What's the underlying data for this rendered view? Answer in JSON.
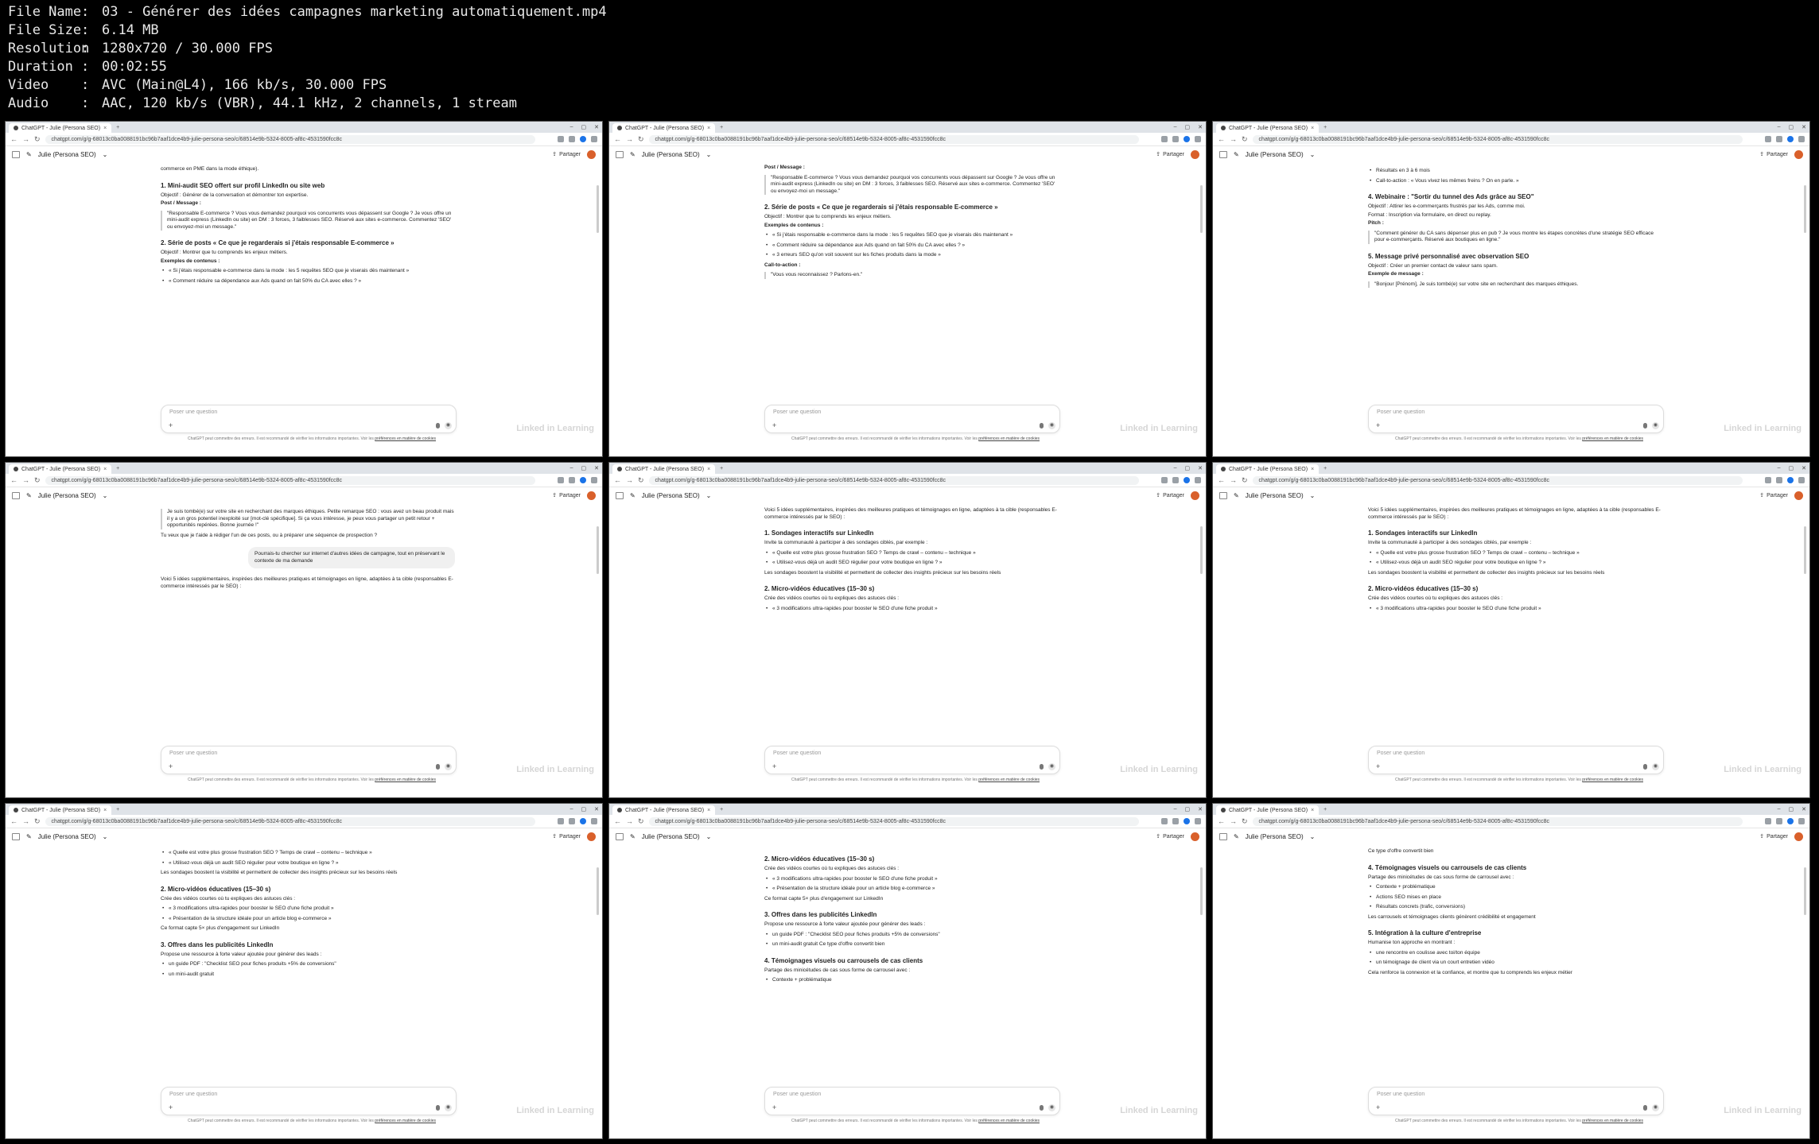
{
  "file_info": [
    {
      "key": "File Name",
      "value": "03 - Générer des idées campagnes marketing automatiquement.mp4"
    },
    {
      "key": "File Size",
      "value": "6.14 MB"
    },
    {
      "key": "Resolution",
      "value": "1280x720 / 30.000 FPS"
    },
    {
      "key": "Duration",
      "value": "00:02:55"
    },
    {
      "key": "Video",
      "value": "AVC (Main@L4), 166 kb/s, 30.000 FPS"
    },
    {
      "key": "Audio",
      "value": "AAC, 120 kb/s (VBR), 44.1 kHz, 2 channels, 1 stream"
    }
  ],
  "browser": {
    "tab_title": "ChatGPT - Julie (Persona SEO)",
    "url": "chatgpt.com/g/g-68013c0ba0088191bc96b7aaf1dce4b9-julie-persona-seo/c/68514e9b-5324-8005-af8c-4531590fcc8c",
    "gpt_name": "Julie (Persona SEO)",
    "share_label": "Partager",
    "input_placeholder": "Poser une question",
    "footer_text": "ChatGPT peut commettre des erreurs. Il est recommandé de vérifier les informations importantes. Voir les",
    "footer_link": "préférences en matière de cookies",
    "watermark": "Linked in Learning"
  },
  "tiles": [
    {
      "lines": [
        {
          "t": "commerce en PME dans la mode éthique).",
          "c": "p"
        },
        {
          "t": "1. Mini-audit SEO offert sur profil LinkedIn ou site web",
          "c": "h"
        },
        {
          "t": "Objectif : Générer de la conversation et démontrer ton expertise.",
          "c": "p"
        },
        {
          "t": "Post / Message :",
          "c": "b"
        },
        {
          "t": "\"Responsable E-commerce ? Vous vous demandez pourquoi vos concurrents vous dépassent sur Google ? Je vous offre un mini-audit express (LinkedIn ou site) en DM : 3 forces, 3 faiblesses SEO. Réservé aux sites e-commerce. Commentez 'SEO' ou envoyez-moi un message.\"",
          "c": "quote"
        },
        {
          "t": "2. Série de posts « Ce que je regarderais si j'étais responsable E-commerce »",
          "c": "h"
        },
        {
          "t": "Objectif : Montrer que tu comprends les enjeux métiers.",
          "c": "p"
        },
        {
          "t": "Exemples de contenus :",
          "c": "b"
        },
        {
          "t": "« Si j'étais responsable e-commerce dans la mode : les 5 requêtes SEO que je viserais dès maintenant »",
          "c": "li"
        },
        {
          "t": "« Comment réduire sa dépendance aux Ads quand on fait 50% du CA avec elles ? »",
          "c": "li"
        }
      ]
    },
    {
      "lines": [
        {
          "t": "Post / Message :",
          "c": "b"
        },
        {
          "t": "\"Responsable E-commerce ? Vous vous demandez pourquoi vos concurrents vous dépassent sur Google ? Je vous offre un mini-audit express (LinkedIn ou site) en DM : 3 forces, 3 faiblesses SEO. Réservé aux sites e-commerce. Commentez 'SEO' ou envoyez-moi un message.\"",
          "c": "quote"
        },
        {
          "t": "2. Série de posts « Ce que je regarderais si j'étais responsable E-commerce »",
          "c": "h"
        },
        {
          "t": "Objectif : Montrer que tu comprends les enjeux métiers.",
          "c": "p"
        },
        {
          "t": "Exemples de contenus :",
          "c": "b"
        },
        {
          "t": "« Si j'étais responsable e-commerce dans la mode : les 5 requêtes SEO que je viserais dès maintenant »",
          "c": "li"
        },
        {
          "t": "« Comment réduire sa dépendance aux Ads quand on fait 50% du CA avec elles ? »",
          "c": "li"
        },
        {
          "t": "« 3 erreurs SEO qu'on voit souvent sur les fiches produits dans la mode »",
          "c": "li"
        },
        {
          "t": "Call-to-action :",
          "c": "b"
        },
        {
          "t": "\"Vous vous reconnaissez ? Parlons-en.\"",
          "c": "quote"
        }
      ]
    },
    {
      "lines": [
        {
          "t": "Résultats en 3 à 6 mois",
          "c": "li"
        },
        {
          "t": "Call-to-action : « Vous vivez les mêmes freins ? On en parle. »",
          "c": "li"
        },
        {
          "t": "4. Webinaire : \"Sortir du tunnel des Ads grâce au SEO\"",
          "c": "h"
        },
        {
          "t": "Objectif : Attirer les e-commerçants frustrés par les Ads, comme moi.",
          "c": "p"
        },
        {
          "t": "Format : Inscription via formulaire, en direct ou replay.",
          "c": "p"
        },
        {
          "t": "Pitch :",
          "c": "b"
        },
        {
          "t": "\"Comment générer du CA sans dépenser plus en pub ? Je vous montre les étapes concrètes d'une stratégie SEO efficace pour e-commerçants. Réservé aux boutiques en ligne.\"",
          "c": "quote"
        },
        {
          "t": "5. Message privé personnalisé avec observation SEO",
          "c": "h"
        },
        {
          "t": "Objectif : Créer un premier contact de valeur sans spam.",
          "c": "p"
        },
        {
          "t": "Exemple de message :",
          "c": "b"
        },
        {
          "t": "\"Bonjour [Prénom], Je suis tombé(e) sur votre site en recherchant des marques éthiques.",
          "c": "quote"
        }
      ]
    },
    {
      "lines": [
        {
          "t": "Je suis tombé(e) sur votre site en recherchant des marques éthiques. Petite remarque SEO : vous avez un beau produit mais il y a un gros potentiel inexploité sur [mot-clé spécifique]. Si ça vous intéresse, je peux vous partager un petit retour + opportunités repérées. Bonne journée !\"",
          "c": "quote"
        },
        {
          "t": "Tu veux que je t'aide à rédiger l'un de ces posts, ou à préparer une séquence de prospection ?",
          "c": "p"
        },
        {
          "t": "Pourrais-tu chercher sur internet d'autres idées de campagne, tout en préservant le contexte de ma demande",
          "c": "userbubble"
        },
        {
          "t": "Voici 5 idées supplémentaires, inspirées des meilleures pratiques et témoignages en ligne, adaptées à ta cible (responsables E-commerce intéressés par le SEO) :",
          "c": "p"
        }
      ]
    },
    {
      "lines": [
        {
          "t": "Voici 5 idées supplémentaires, inspirées des meilleures pratiques et témoignages en ligne, adaptées à ta cible (responsables E-commerce intéressés par le SEO) :",
          "c": "p"
        },
        {
          "t": "1. Sondages interactifs sur LinkedIn",
          "c": "h"
        },
        {
          "t": "Invite ta communauté à participer à des sondages ciblés, par exemple :",
          "c": "p"
        },
        {
          "t": "« Quelle est votre plus grosse frustration SEO ? Temps de crawl – contenu – technique »",
          "c": "li"
        },
        {
          "t": "« Utilisez-vous déjà un audit SEO régulier pour votre boutique en ligne ? »",
          "c": "li"
        },
        {
          "t": "Les sondages boostent la visibilité et permettent de collecter des insights précieux sur les besoins réels",
          "c": "p"
        },
        {
          "t": "2. Micro-vidéos éducatives (15–30 s)",
          "c": "h"
        },
        {
          "t": "Crée des vidéos courtes où tu expliques des astuces clés :",
          "c": "p"
        },
        {
          "t": "« 3 modifications ultra-rapides pour booster le SEO d'une fiche produit »",
          "c": "li"
        }
      ]
    },
    {
      "lines": [
        {
          "t": "Voici 5 idées supplémentaires, inspirées des meilleures pratiques et témoignages en ligne, adaptées à ta cible (responsables E-commerce intéressés par le SEO) :",
          "c": "p"
        },
        {
          "t": "1. Sondages interactifs sur LinkedIn",
          "c": "h"
        },
        {
          "t": "Invite ta communauté à participer à des sondages ciblés, par exemple :",
          "c": "p"
        },
        {
          "t": "« Quelle est votre plus grosse frustration SEO ? Temps de crawl – contenu – technique »",
          "c": "li"
        },
        {
          "t": "« Utilisez-vous déjà un audit SEO régulier pour votre boutique en ligne ? »",
          "c": "li"
        },
        {
          "t": "Les sondages boostent la visibilité et permettent de collecter des insights précieux sur les besoins réels",
          "c": "p"
        },
        {
          "t": "2. Micro-vidéos éducatives (15–30 s)",
          "c": "h"
        },
        {
          "t": "Crée des vidéos courtes où tu expliques des astuces clés :",
          "c": "p"
        },
        {
          "t": "« 3 modifications ultra-rapides pour booster le SEO d'une fiche produit »",
          "c": "li"
        }
      ]
    },
    {
      "lines": [
        {
          "t": "« Quelle est votre plus grosse frustration SEO ? Temps de crawl – contenu – technique »",
          "c": "li"
        },
        {
          "t": "« Utilisez-vous déjà un audit SEO régulier pour votre boutique en ligne ? »",
          "c": "li"
        },
        {
          "t": "Les sondages boostent la visibilité et permettent de collecter des insights précieux sur les besoins réels",
          "c": "p"
        },
        {
          "t": "2. Micro-vidéos éducatives (15–30 s)",
          "c": "h"
        },
        {
          "t": "Crée des vidéos courtes où tu expliques des astuces clés :",
          "c": "p"
        },
        {
          "t": "« 3 modifications ultra-rapides pour booster le SEO d'une fiche produit »",
          "c": "li"
        },
        {
          "t": "« Présentation de la structure idéale pour un article blog e-commerce »",
          "c": "li"
        },
        {
          "t": "Ce format capte 5× plus d'engagement sur LinkedIn",
          "c": "p"
        },
        {
          "t": "3. Offres dans les publicités LinkedIn",
          "c": "h"
        },
        {
          "t": "Propose une ressource à forte valeur ajoutée pour générer des leads :",
          "c": "p"
        },
        {
          "t": "un guide PDF : \"Checklist SEO pour fiches produits +5% de conversions\"",
          "c": "li"
        },
        {
          "t": "un mini-audit gratuit",
          "c": "li"
        }
      ]
    },
    {
      "lines": [
        {
          "t": "2. Micro-vidéos éducatives (15–30 s)",
          "c": "h"
        },
        {
          "t": "Crée des vidéos courtes où tu expliques des astuces clés :",
          "c": "p"
        },
        {
          "t": "« 3 modifications ultra-rapides pour booster le SEO d'une fiche produit »",
          "c": "li"
        },
        {
          "t": "« Présentation de la structure idéale pour un article blog e-commerce »",
          "c": "li"
        },
        {
          "t": "Ce format capte 5× plus d'engagement sur LinkedIn",
          "c": "p"
        },
        {
          "t": "3. Offres dans les publicités LinkedIn",
          "c": "h"
        },
        {
          "t": "Propose une ressource à forte valeur ajoutée pour générer des leads :",
          "c": "p"
        },
        {
          "t": "un guide PDF : \"Checklist SEO pour fiches produits +5% de conversions\"",
          "c": "li"
        },
        {
          "t": "un mini-audit gratuit  Ce type d'offre convertit bien",
          "c": "li"
        },
        {
          "t": "4. Témoignages visuels ou carrousels de cas clients",
          "c": "h"
        },
        {
          "t": "Partage des minicétudes de cas sous forme de carrousel avec :",
          "c": "p"
        },
        {
          "t": "Contexte + problématique",
          "c": "li"
        }
      ]
    },
    {
      "lines": [
        {
          "t": "Ce type d'offre convertit bien",
          "c": "p"
        },
        {
          "t": "4. Témoignages visuels ou carrousels de cas clients",
          "c": "h"
        },
        {
          "t": "Partage des minicétudes de cas sous forme de carrousel avec :",
          "c": "p"
        },
        {
          "t": "Contexte + problématique",
          "c": "li"
        },
        {
          "t": "Actions SEO mises en place",
          "c": "li"
        },
        {
          "t": "Résultats concrets (trafic, conversions)",
          "c": "li"
        },
        {
          "t": "Les carrousels et témoignages clients génèrent crédibilité et engagement",
          "c": "p"
        },
        {
          "t": "5. Intégration à la culture d'entreprise",
          "c": "h"
        },
        {
          "t": "Humanise ton approche en montrant :",
          "c": "p"
        },
        {
          "t": "une rencontre en coulisse avec toi/ton équipe",
          "c": "li"
        },
        {
          "t": "un témoignage de client via un court entretien vidéo",
          "c": "li"
        },
        {
          "t": "Cela renforce la connexion et la confiance, et montre que tu comprends les enjeux métier",
          "c": "p"
        }
      ]
    }
  ]
}
